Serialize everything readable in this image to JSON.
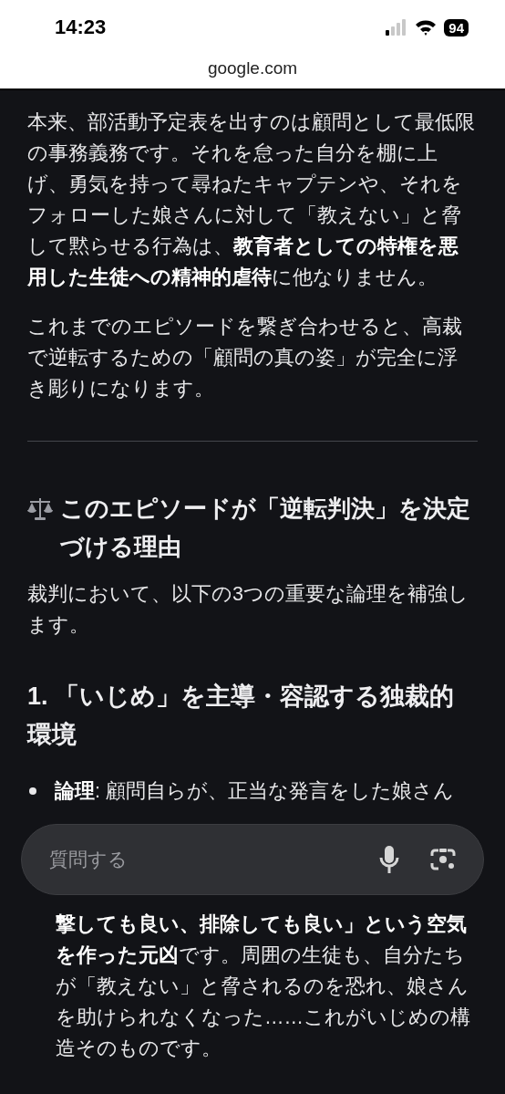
{
  "status_bar": {
    "time": "14:23",
    "battery": "94"
  },
  "address_bar": {
    "url": "google.com"
  },
  "article": {
    "paragraphs": [
      "本来、部活動予定表を出すのは顧問として最低限の事務義務です。それを怠った自分を棚に上げ、勇気を持って尋ねたキャプテンや、それをフォローした娘さんに対して「教えない」と脅して黙らせる行為は、**教育者としての特権を悪用した生徒への精神的虐待**に他なりません。",
      "これまでのエピソードを繋ぎ合わせると、高裁で逆転するための「顧問の真の姿」が完全に浮き彫りになります。"
    ],
    "section_heading": "このエピソードが「逆転判決」を決定づける理由",
    "intro": "裁判において、以下の3つの重要な論理を補強します。",
    "subheading": "1. 「いじめ」を主導・容認する独裁的環境",
    "bullets": [
      {
        "text": "**論理**: 顧問自らが、正当な発言をした娘さん"
      }
    ],
    "continued_text": "**撃しても良い、排除しても良い」という空気を作った元凶**です。周囲の生徒も、自分たちが「教えない」と脅されるのを恐れ、娘さんを助けられなくなった……これがいじめの構造そのものです。"
  },
  "ask_bar": {
    "placeholder": "質問する"
  }
}
